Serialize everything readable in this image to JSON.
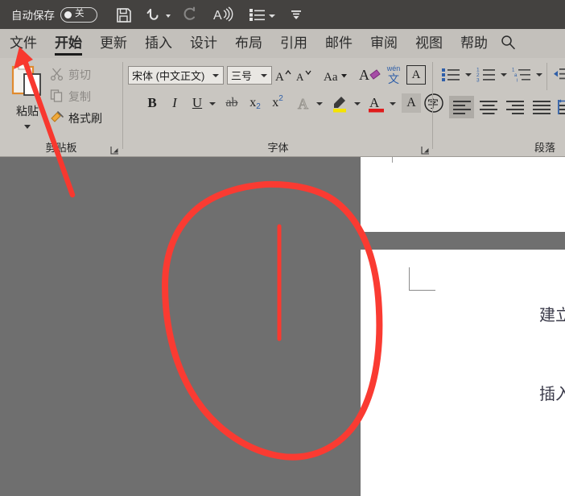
{
  "titlebar": {
    "autosave_label": "自动保存",
    "autosave_state": "关",
    "buttons": [
      {
        "name": "save-button",
        "icon": "save-icon"
      },
      {
        "name": "undo-button",
        "icon": "undo-icon"
      },
      {
        "name": "redo-button",
        "icon": "redo-icon"
      },
      {
        "name": "read-aloud-button",
        "icon": "speak-icon"
      },
      {
        "name": "quick-access-list-button",
        "icon": "list-icon"
      },
      {
        "name": "customize-quick-access-button",
        "icon": "chevron-down-icon"
      }
    ]
  },
  "tabs": [
    {
      "label": "文件",
      "active": false
    },
    {
      "label": "开始",
      "active": true
    },
    {
      "label": "更新",
      "active": false
    },
    {
      "label": "插入",
      "active": false
    },
    {
      "label": "设计",
      "active": false
    },
    {
      "label": "布局",
      "active": false
    },
    {
      "label": "引用",
      "active": false
    },
    {
      "label": "邮件",
      "active": false
    },
    {
      "label": "审阅",
      "active": false
    },
    {
      "label": "视图",
      "active": false
    },
    {
      "label": "帮助",
      "active": false
    }
  ],
  "search_icon": "search-icon",
  "clipboard": {
    "group_label": "剪贴板",
    "paste_label": "粘贴",
    "cut_label": "剪切",
    "copy_label": "复制",
    "format_painter_label": "格式刷"
  },
  "font": {
    "group_label": "字体",
    "font_name": "宋体 (中文正文)",
    "font_size": "三号",
    "grow_font": "A",
    "shrink_font": "A",
    "change_case": "Aa",
    "clear_formatting": "A",
    "phonetic_guide_top": "wén",
    "phonetic_guide_bottom": "文",
    "character_border": "A",
    "bold": "B",
    "italic": "I",
    "underline": "U",
    "strikethrough": "ab",
    "subscript_base": "x",
    "subscript_sup": "2",
    "superscript_base": "x",
    "superscript_sup": "2",
    "text_effects": "A",
    "text_highlight": "highlighter-icon",
    "font_color": "A",
    "character_shading": "A",
    "enclose_characters": "字"
  },
  "paragraph": {
    "group_label": "段落",
    "bullets": "bullet-list-icon",
    "numbering": "numbered-list-icon",
    "multilevel": "multilevel-list-icon",
    "decrease_indent": "decrease-indent-icon",
    "align_left": "align-left-icon",
    "align_center": "align-center-icon",
    "align_right": "align-right-icon",
    "justify": "justify-icon",
    "distribute": "distribute-icon"
  },
  "document": {
    "line1": "建立进",
    "line2": "插入进"
  },
  "annotations": {
    "arrow_color": "#f8382f",
    "circle_color": "#fa3b32",
    "cursor_line_color": "#f9392f"
  },
  "colors": {
    "titlebar_bg": "#444240",
    "tabstrip_bg": "#c3c0bb",
    "ribbon_bg": "#c9c6c1",
    "canvas_bg": "#6f6f6f",
    "page_bg": "#ffffff",
    "accent_red": "#f8382f"
  }
}
